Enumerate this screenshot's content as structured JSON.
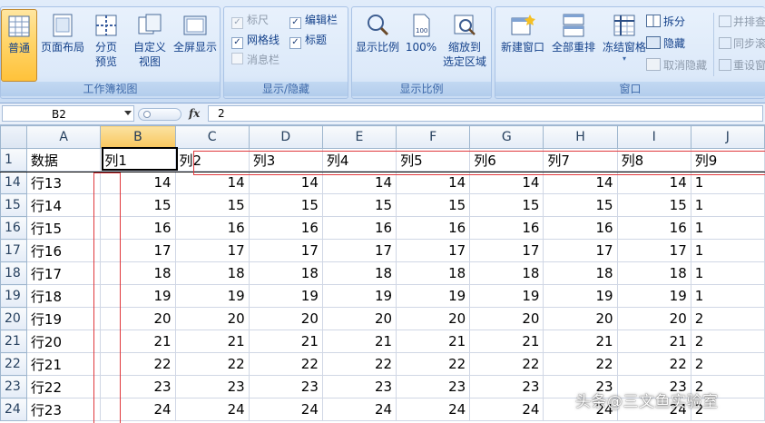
{
  "ribbon": {
    "group_workbook_views": {
      "title": "工作簿视图",
      "buttons": [
        {
          "label": "普通",
          "active": true
        },
        {
          "label": "页面布局"
        },
        {
          "label": "分页\n预览"
        },
        {
          "label": "自定义\n视图"
        },
        {
          "label": "全屏显示"
        }
      ]
    },
    "group_show_hide": {
      "title": "显示/隐藏",
      "ruler": {
        "label": "标尺",
        "checked": true,
        "disabled": true
      },
      "gridlines": {
        "label": "网格线",
        "checked": true
      },
      "message_bar": {
        "label": "消息栏",
        "checked": false,
        "disabled": true
      },
      "formula_bar": {
        "label": "编辑栏",
        "checked": true
      },
      "headings": {
        "label": "标题",
        "checked": true
      }
    },
    "group_zoom": {
      "title": "显示比例",
      "zoom": "显示比例",
      "zoom_100": "100%",
      "zoom_selection": "缩放到\n选定区域"
    },
    "group_window": {
      "title": "窗口",
      "new_window": "新建窗口",
      "arrange_all": "全部重排",
      "freeze_panes": "冻结窗格",
      "split": "拆分",
      "hide": "隐藏",
      "unhide": "取消隐藏",
      "side_by_side": "并排查",
      "sync_scroll": "同步滚",
      "reset_position": "重设窗"
    }
  },
  "formula_bar": {
    "name_box": "B2",
    "fx": "fx",
    "value": "2"
  },
  "grid": {
    "columns": [
      "A",
      "B",
      "C",
      "D",
      "E",
      "F",
      "G",
      "H",
      "I",
      "J"
    ],
    "selected_column": "B",
    "header_row": {
      "row": "1",
      "cells": [
        "数据",
        "列1",
        "列2",
        "列3",
        "列4",
        "列5",
        "列6",
        "列7",
        "列8",
        "列9"
      ]
    },
    "rows": [
      {
        "row": "14",
        "label": "行13",
        "value": "14"
      },
      {
        "row": "15",
        "label": "行14",
        "value": "15"
      },
      {
        "row": "16",
        "label": "行15",
        "value": "16"
      },
      {
        "row": "17",
        "label": "行16",
        "value": "17"
      },
      {
        "row": "18",
        "label": "行17",
        "value": "18"
      },
      {
        "row": "19",
        "label": "行18",
        "value": "19"
      },
      {
        "row": "20",
        "label": "行19",
        "value": "20"
      },
      {
        "row": "21",
        "label": "行20",
        "value": "21"
      },
      {
        "row": "22",
        "label": "行21",
        "value": "22"
      },
      {
        "row": "23",
        "label": "行22",
        "value": "23"
      },
      {
        "row": "24",
        "label": "行23",
        "value": "24"
      }
    ],
    "last_column_partial_values": [
      "1",
      "1",
      "1",
      "1",
      "1",
      "1",
      "2",
      "2",
      "2",
      "2",
      "2"
    ]
  },
  "watermark": "头条@三文鱼实验室",
  "colors": {
    "ribbon_bg": "#d6e5f7",
    "active_button": "#ffd56a",
    "selected_header": "#f9c65c",
    "annotation_red": "#e0383c"
  }
}
